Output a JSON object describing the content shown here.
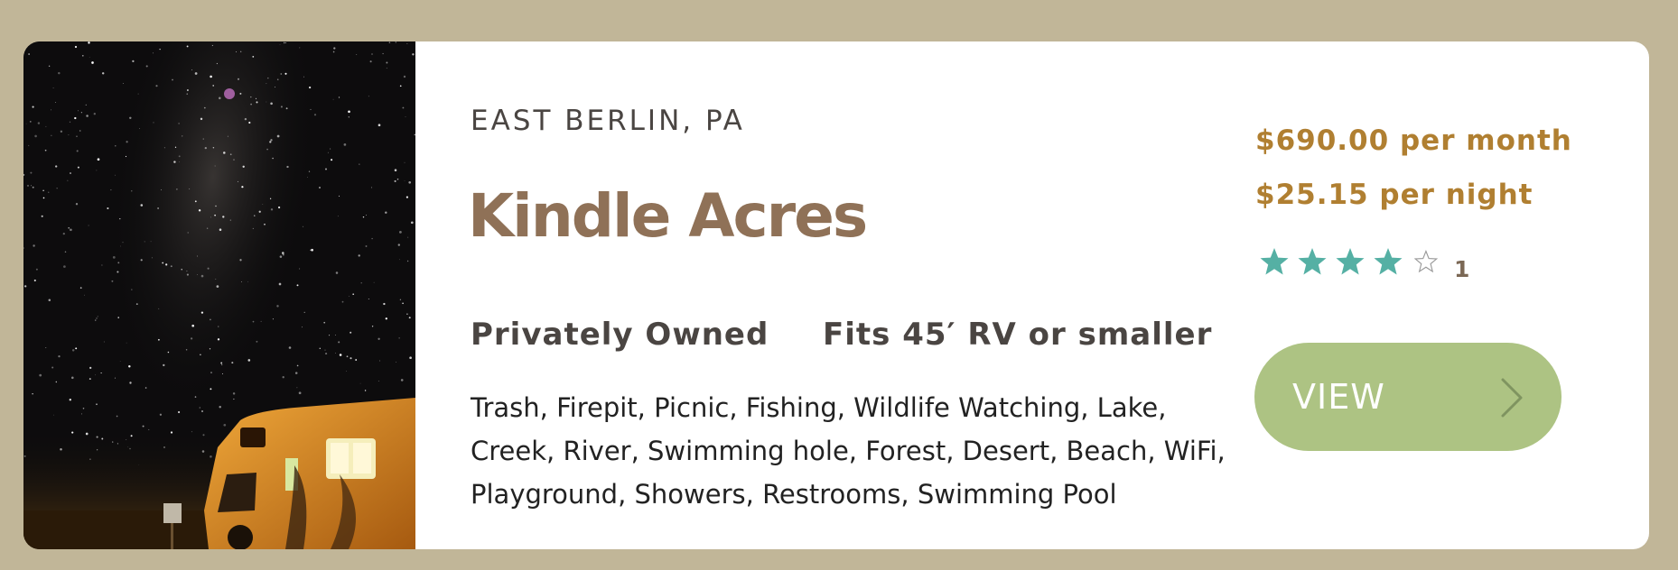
{
  "listing": {
    "location": "EAST BERLIN, PA",
    "name": "Kindle Acres",
    "features": {
      "ownership": "Privately Owned",
      "rv_fit": "Fits 45′ RV or smaller"
    },
    "amenities": "Trash, Firepit, Picnic, Fishing, Wildlife Watching, Lake, Creek, River, Swimming hole, Forest, Desert, Beach, WiFi, Playground, Showers, Restrooms, Swimming Pool",
    "pricing": {
      "monthly": "$690.00 per month",
      "nightly": "$25.15 per night"
    },
    "rating": {
      "stars": 4,
      "max_stars": 5,
      "review_count": "1"
    },
    "view_button": {
      "label": "VIEW",
      "icon": "chevron-right-icon"
    },
    "photo": {
      "subject": "camper-van-under-starry-sky"
    }
  },
  "colors": {
    "page_background": "#c1b698",
    "card_background": "#ffffff",
    "name_brown": "#8f7157",
    "price_gold": "#b07f31",
    "star_teal": "#55b0a4",
    "button_green": "#adc383"
  }
}
